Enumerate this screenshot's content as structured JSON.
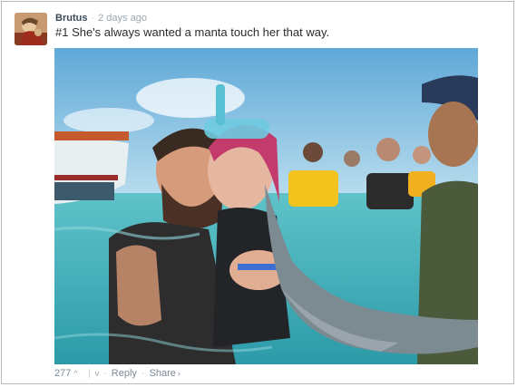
{
  "comment": {
    "author": "Brutus",
    "separator": "·",
    "time": "2 days ago",
    "text": "#1 She's always wanted a manta touch her that way."
  },
  "footer": {
    "votes": "277",
    "upvote_icon": "^",
    "downvote_icon": "v",
    "dot": "·",
    "reply_label": "Reply",
    "share_label": "Share",
    "share_chevron": "›"
  },
  "colors": {
    "author": "#3a4a57",
    "meta": "#9aa6b0",
    "text": "#2a2e2e",
    "border": "#b9b9b9"
  },
  "icons": [
    "user-avatar",
    "upvote-icon",
    "downvote-icon",
    "share-chevron-icon"
  ]
}
